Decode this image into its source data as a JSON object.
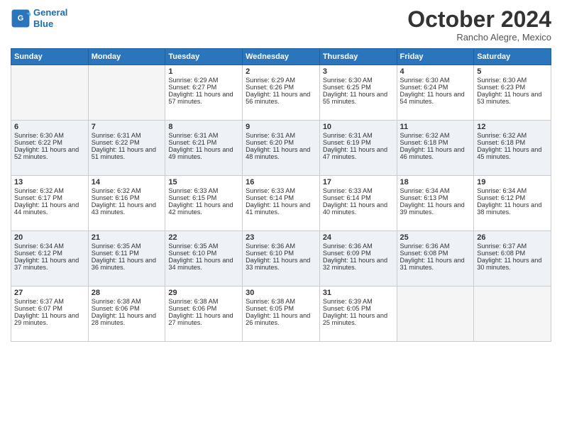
{
  "logo": {
    "line1": "General",
    "line2": "Blue"
  },
  "title": "October 2024",
  "subtitle": "Rancho Alegre, Mexico",
  "header_days": [
    "Sunday",
    "Monday",
    "Tuesday",
    "Wednesday",
    "Thursday",
    "Friday",
    "Saturday"
  ],
  "weeks": [
    [
      {
        "day": "",
        "empty": true
      },
      {
        "day": "",
        "empty": true
      },
      {
        "day": "1",
        "sunrise": "Sunrise: 6:29 AM",
        "sunset": "Sunset: 6:27 PM",
        "daylight": "Daylight: 11 hours and 57 minutes."
      },
      {
        "day": "2",
        "sunrise": "Sunrise: 6:29 AM",
        "sunset": "Sunset: 6:26 PM",
        "daylight": "Daylight: 11 hours and 56 minutes."
      },
      {
        "day": "3",
        "sunrise": "Sunrise: 6:30 AM",
        "sunset": "Sunset: 6:25 PM",
        "daylight": "Daylight: 11 hours and 55 minutes."
      },
      {
        "day": "4",
        "sunrise": "Sunrise: 6:30 AM",
        "sunset": "Sunset: 6:24 PM",
        "daylight": "Daylight: 11 hours and 54 minutes."
      },
      {
        "day": "5",
        "sunrise": "Sunrise: 6:30 AM",
        "sunset": "Sunset: 6:23 PM",
        "daylight": "Daylight: 11 hours and 53 minutes."
      }
    ],
    [
      {
        "day": "6",
        "sunrise": "Sunrise: 6:30 AM",
        "sunset": "Sunset: 6:22 PM",
        "daylight": "Daylight: 11 hours and 52 minutes."
      },
      {
        "day": "7",
        "sunrise": "Sunrise: 6:31 AM",
        "sunset": "Sunset: 6:22 PM",
        "daylight": "Daylight: 11 hours and 51 minutes."
      },
      {
        "day": "8",
        "sunrise": "Sunrise: 6:31 AM",
        "sunset": "Sunset: 6:21 PM",
        "daylight": "Daylight: 11 hours and 49 minutes."
      },
      {
        "day": "9",
        "sunrise": "Sunrise: 6:31 AM",
        "sunset": "Sunset: 6:20 PM",
        "daylight": "Daylight: 11 hours and 48 minutes."
      },
      {
        "day": "10",
        "sunrise": "Sunrise: 6:31 AM",
        "sunset": "Sunset: 6:19 PM",
        "daylight": "Daylight: 11 hours and 47 minutes."
      },
      {
        "day": "11",
        "sunrise": "Sunrise: 6:32 AM",
        "sunset": "Sunset: 6:18 PM",
        "daylight": "Daylight: 11 hours and 46 minutes."
      },
      {
        "day": "12",
        "sunrise": "Sunrise: 6:32 AM",
        "sunset": "Sunset: 6:18 PM",
        "daylight": "Daylight: 11 hours and 45 minutes."
      }
    ],
    [
      {
        "day": "13",
        "sunrise": "Sunrise: 6:32 AM",
        "sunset": "Sunset: 6:17 PM",
        "daylight": "Daylight: 11 hours and 44 minutes."
      },
      {
        "day": "14",
        "sunrise": "Sunrise: 6:32 AM",
        "sunset": "Sunset: 6:16 PM",
        "daylight": "Daylight: 11 hours and 43 minutes."
      },
      {
        "day": "15",
        "sunrise": "Sunrise: 6:33 AM",
        "sunset": "Sunset: 6:15 PM",
        "daylight": "Daylight: 11 hours and 42 minutes."
      },
      {
        "day": "16",
        "sunrise": "Sunrise: 6:33 AM",
        "sunset": "Sunset: 6:14 PM",
        "daylight": "Daylight: 11 hours and 41 minutes."
      },
      {
        "day": "17",
        "sunrise": "Sunrise: 6:33 AM",
        "sunset": "Sunset: 6:14 PM",
        "daylight": "Daylight: 11 hours and 40 minutes."
      },
      {
        "day": "18",
        "sunrise": "Sunrise: 6:34 AM",
        "sunset": "Sunset: 6:13 PM",
        "daylight": "Daylight: 11 hours and 39 minutes."
      },
      {
        "day": "19",
        "sunrise": "Sunrise: 6:34 AM",
        "sunset": "Sunset: 6:12 PM",
        "daylight": "Daylight: 11 hours and 38 minutes."
      }
    ],
    [
      {
        "day": "20",
        "sunrise": "Sunrise: 6:34 AM",
        "sunset": "Sunset: 6:12 PM",
        "daylight": "Daylight: 11 hours and 37 minutes."
      },
      {
        "day": "21",
        "sunrise": "Sunrise: 6:35 AM",
        "sunset": "Sunset: 6:11 PM",
        "daylight": "Daylight: 11 hours and 36 minutes."
      },
      {
        "day": "22",
        "sunrise": "Sunrise: 6:35 AM",
        "sunset": "Sunset: 6:10 PM",
        "daylight": "Daylight: 11 hours and 34 minutes."
      },
      {
        "day": "23",
        "sunrise": "Sunrise: 6:36 AM",
        "sunset": "Sunset: 6:10 PM",
        "daylight": "Daylight: 11 hours and 33 minutes."
      },
      {
        "day": "24",
        "sunrise": "Sunrise: 6:36 AM",
        "sunset": "Sunset: 6:09 PM",
        "daylight": "Daylight: 11 hours and 32 minutes."
      },
      {
        "day": "25",
        "sunrise": "Sunrise: 6:36 AM",
        "sunset": "Sunset: 6:08 PM",
        "daylight": "Daylight: 11 hours and 31 minutes."
      },
      {
        "day": "26",
        "sunrise": "Sunrise: 6:37 AM",
        "sunset": "Sunset: 6:08 PM",
        "daylight": "Daylight: 11 hours and 30 minutes."
      }
    ],
    [
      {
        "day": "27",
        "sunrise": "Sunrise: 6:37 AM",
        "sunset": "Sunset: 6:07 PM",
        "daylight": "Daylight: 11 hours and 29 minutes."
      },
      {
        "day": "28",
        "sunrise": "Sunrise: 6:38 AM",
        "sunset": "Sunset: 6:06 PM",
        "daylight": "Daylight: 11 hours and 28 minutes."
      },
      {
        "day": "29",
        "sunrise": "Sunrise: 6:38 AM",
        "sunset": "Sunset: 6:06 PM",
        "daylight": "Daylight: 11 hours and 27 minutes."
      },
      {
        "day": "30",
        "sunrise": "Sunrise: 6:38 AM",
        "sunset": "Sunset: 6:05 PM",
        "daylight": "Daylight: 11 hours and 26 minutes."
      },
      {
        "day": "31",
        "sunrise": "Sunrise: 6:39 AM",
        "sunset": "Sunset: 6:05 PM",
        "daylight": "Daylight: 11 hours and 25 minutes."
      },
      {
        "day": "",
        "empty": true
      },
      {
        "day": "",
        "empty": true
      }
    ]
  ]
}
